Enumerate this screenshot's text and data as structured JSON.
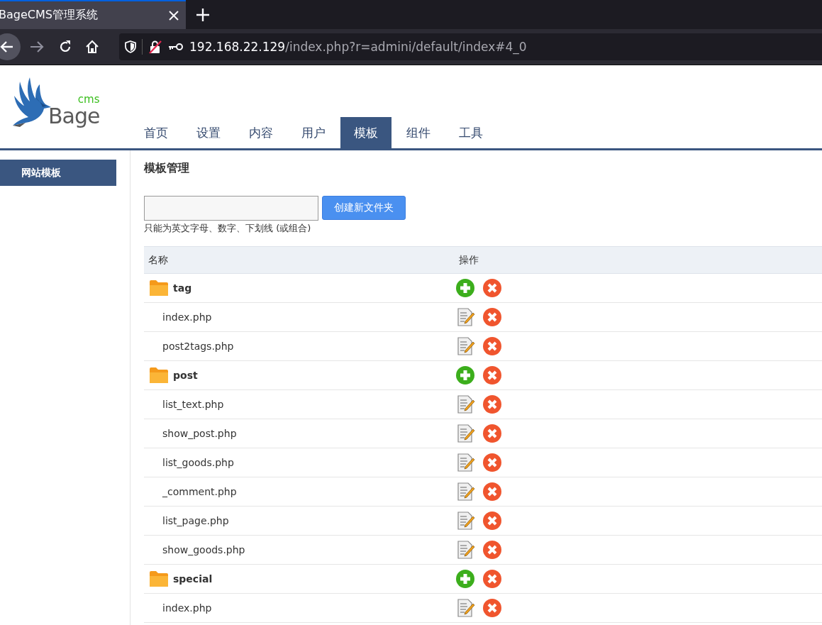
{
  "browser": {
    "tab_title": "BageCMS管理系统",
    "url_host": "192.168.22.129",
    "url_path": "/index.php?r=admini/default/index#4_0"
  },
  "logo": {
    "name": "Bage",
    "sup": "cms"
  },
  "nav": [
    {
      "label": "首页",
      "selected": false
    },
    {
      "label": "设置",
      "selected": false
    },
    {
      "label": "内容",
      "selected": false
    },
    {
      "label": "用户",
      "selected": false
    },
    {
      "label": "模板",
      "selected": true
    },
    {
      "label": "组件",
      "selected": false
    },
    {
      "label": "工具",
      "selected": false
    }
  ],
  "sidebar": {
    "items": [
      {
        "label": "网站模板",
        "selected": true
      }
    ]
  },
  "main": {
    "title": "模板管理",
    "create_button": "创建新文件夹",
    "hint": "只能为英文字母、数字、下划线 (或组合)",
    "table": {
      "columns": [
        "名称",
        "操作"
      ],
      "rows": [
        {
          "kind": "folder",
          "name": "tag"
        },
        {
          "kind": "file",
          "name": "index.php"
        },
        {
          "kind": "file",
          "name": "post2tags.php"
        },
        {
          "kind": "folder",
          "name": "post"
        },
        {
          "kind": "file",
          "name": "list_text.php"
        },
        {
          "kind": "file",
          "name": "show_post.php"
        },
        {
          "kind": "file",
          "name": "list_goods.php"
        },
        {
          "kind": "file",
          "name": "_comment.php"
        },
        {
          "kind": "file",
          "name": "list_page.php"
        },
        {
          "kind": "file",
          "name": "show_goods.php"
        },
        {
          "kind": "folder",
          "name": "special"
        },
        {
          "kind": "file",
          "name": "index.php"
        }
      ]
    }
  }
}
